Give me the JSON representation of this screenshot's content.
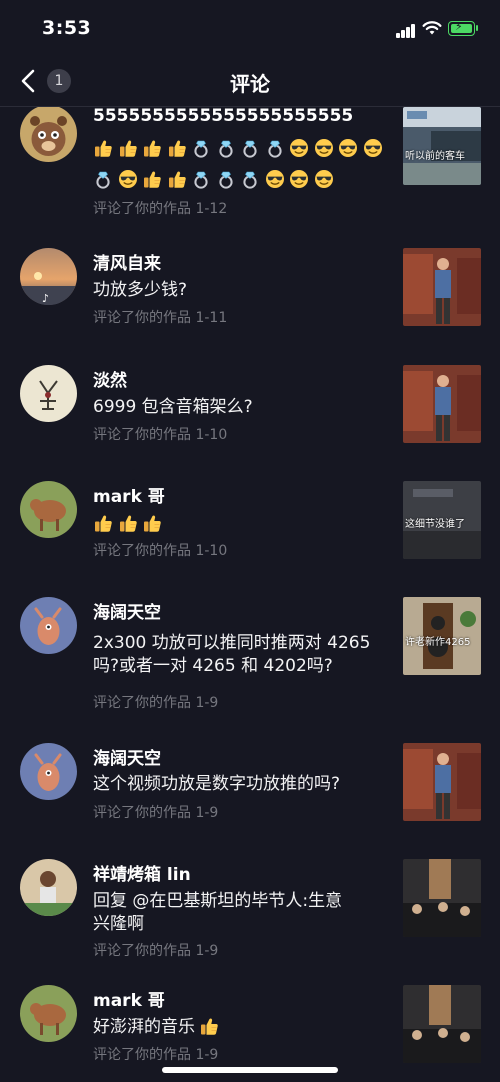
{
  "status_bar": {
    "time": "3:53"
  },
  "nav": {
    "title": "评论",
    "back_badge": "1"
  },
  "comments": [
    {
      "name": "5555555555555555555555",
      "text": "",
      "reactions_row1": [
        "thumbs-up",
        "thumbs-up",
        "thumbs-up",
        "thumbs-up",
        "ring",
        "ring",
        "ring",
        "ring",
        "sunglasses",
        "sunglasses",
        "sunglasses",
        "sunglasses"
      ],
      "reactions_row2": [
        "ring",
        "sunglasses",
        "thumbs-up",
        "thumbs-up",
        "ring",
        "ring",
        "ring",
        "sunglasses",
        "sunglasses",
        "sunglasses"
      ],
      "meta": "评论了你的作品 1-12",
      "thumb_caption": "听以前的客车"
    },
    {
      "name": "清风自来",
      "text": "功放多少钱?",
      "meta": "评论了你的作品 1-11"
    },
    {
      "name": "淡然",
      "text": "6999 包含音箱架么?",
      "meta": "评论了你的作品 1-10"
    },
    {
      "name": "mark 哥",
      "text": "",
      "reactions": [
        "thumbs-up",
        "thumbs-up",
        "thumbs-up"
      ],
      "meta": "评论了你的作品 1-10",
      "thumb_caption": "这细节没谁了"
    },
    {
      "name": "海阔天空",
      "text_line1": "2x300 功放可以推同时推两对 4265",
      "text_line2": "吗?或者一对 4265 和 4202吗?",
      "meta": "评论了你的作品 1-9",
      "thumb_caption": "许老新作4265"
    },
    {
      "name": "海阔天空",
      "text": "这个视频功放是数字功放推的吗?",
      "meta": "评论了你的作品 1-9"
    },
    {
      "name": "祥靖烤箱 lin",
      "text_line1": "回复 @在巴基斯坦的毕节人:生意",
      "text_line2": "兴隆啊",
      "meta": "评论了你的作品 1-9"
    },
    {
      "name": "mark 哥",
      "text": "好澎湃的音乐",
      "reactions": [
        "thumbs-up"
      ],
      "meta": "评论了你的作品 1-9"
    }
  ],
  "colors": {
    "background": "#161722",
    "meta_text": "#76777f",
    "battery": "#4cd964"
  }
}
